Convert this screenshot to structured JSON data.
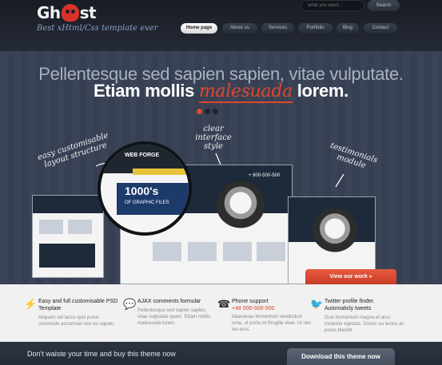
{
  "header": {
    "logo_text_before": "Gh",
    "logo_text_after": "st",
    "tagline": "Best xHtml/Css template ever",
    "search": {
      "placeholder": "what you want...",
      "button_label": "Search"
    },
    "nav": [
      {
        "label": "Home page",
        "active": true
      },
      {
        "label": "About us",
        "active": false
      },
      {
        "label": "Services",
        "active": false
      },
      {
        "label": "Portfolio",
        "active": false
      },
      {
        "label": "Blog",
        "active": false
      },
      {
        "label": "Contact",
        "active": false
      }
    ]
  },
  "hero": {
    "line1": "Pellentesque sed sapien sapien, vitae vulputate.",
    "line2_before": "Etiam mollis",
    "line2_highlight": "malesuada",
    "line2_after": "lorem.",
    "slides": [
      {
        "active": true
      },
      {
        "active": false
      },
      {
        "active": false
      }
    ],
    "annotations": {
      "easy": "easy customisable layout structure",
      "clear": "clear interface style",
      "testimonials": "testimonials module"
    },
    "mockup": {
      "brand": "WEB FORGE",
      "big_text": "1000's",
      "sub_text": "OF GRAPHIC FILES",
      "phone": "+ 800-500-500"
    },
    "cta_label": "View our work »"
  },
  "features": [
    {
      "icon": "lightning-icon",
      "title": "Easy and full customisable PSD Template",
      "title_color": "#222222",
      "body": "Aliquam vel lacus quis purus commodo accumsan nec eu sapien."
    },
    {
      "icon": "speech-bubble-icon",
      "title": "AJAX comments formular",
      "title_color": "#222222",
      "body": "Pellentesque sed sapien sapien, vitae vulputate quam. Etiam mollis malesuada lorem."
    },
    {
      "icon": "phone-icon",
      "title": "Phone support",
      "subtitle": "+48 500-500-500",
      "title_color": "#d6412a",
      "body": "Maecenas fermentum vestibulum urna, ut porta mi fringilla vitae. Ut nec leo eros."
    },
    {
      "icon": "twitter-bird-icon",
      "title": "Twitter profile finder. Automaticly tweets",
      "title_color": "#222222",
      "body": "Duis fermentum magna et arcu molestie egestas. Donec eu lectus ac purus blandit."
    }
  ],
  "banner": {
    "text": "Don't waiste your time and buy this theme now",
    "button_label": "Download this theme now"
  },
  "colors": {
    "accent": "#e0462f",
    "dark": "#1e2430",
    "hero_bg": "#3b4456"
  }
}
